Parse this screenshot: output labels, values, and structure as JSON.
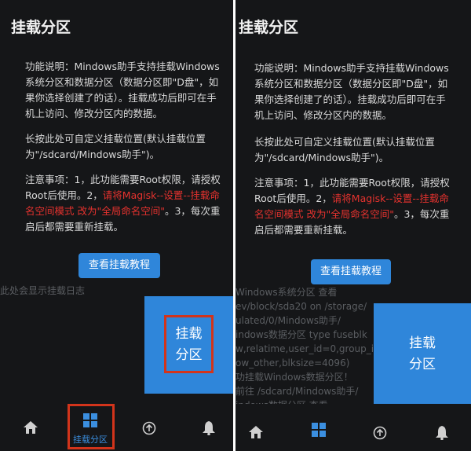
{
  "left": {
    "title": "挂载分区",
    "function_desc": "功能说明：Mindows助手支持挂载Windows\n系统分区和数据分区（数据分区即\"D盘\"，如\n果你选择创建了的话）。挂载成功后即可在手\n机上访问、修改分区内的数据。",
    "long_press": "长按此处可自定义挂载位置(默认挂载位置\n为\"/sdcard/Mindows助手\")。",
    "notes_a": "注意事项：1，此功能需要Root权限，请授权\nRoot后使用。2，",
    "notes_red": "请将Magisk--设置--挂载命\n名空间模式 改为\"全局命名空间\"",
    "notes_b": "。3，每次重\n启后都需要重新挂载。",
    "tutorial_button": "查看挂载教程",
    "log_placeholder": "此处会显示挂载日志",
    "mount_button": "挂载\n分区",
    "nav_label": "挂载分区"
  },
  "right": {
    "title": "挂载分区",
    "function_desc": "功能说明：Mindows助手支持挂载Windows\n系统分区和数据分区（数据分区即\"D盘\"，如\n果你选择创建了的话）。挂载成功后即可在手\n机上访问、修改分区内的数据。",
    "long_press": "长按此处可自定义挂载位置(默认挂载位置\n为\"/sdcard/Mindows助手\")。",
    "notes_a": "注意事项：1，此功能需要Root权限，请授权\nRoot后使用。2，",
    "notes_red": "请将Magisk--设置--挂载命\n名空间模式 改为\"全局命名空间\"",
    "notes_b": "。3，每次重\n启后都需要重新挂载。",
    "tutorial_button": "查看挂载教程",
    "log": "Windows系统分区 查看\nev/block/sda20 on /storage/\nulated/0/Mindows助手/\nindows数据分区 type fuseblk\nw,relatime,user_id=0,group_id=0,\now_other,blksize=4096)\n功挂载Windows数据分区！\n前往 /sdcard/Mindows助手/\nindows数据分区 查看",
    "mount_button": "挂载\n分区"
  },
  "icons": {
    "home": "home-icon",
    "grid": "grid-icon",
    "upload": "upload-circle-icon",
    "bell": "bell-icon"
  },
  "colors": {
    "background": "#151618",
    "accent": "#2f86da",
    "warning": "#e5322e",
    "highlight": "#d2341b"
  }
}
